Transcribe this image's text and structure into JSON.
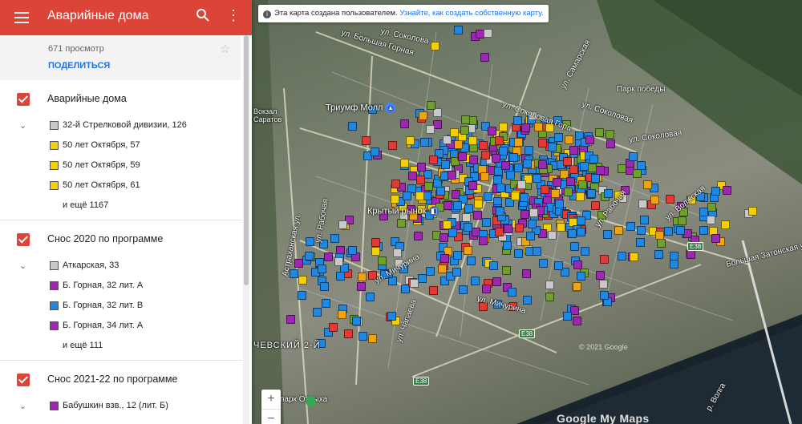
{
  "app": {
    "title": "Аварийные дома",
    "views": "671 просмотр",
    "share_label": "ПОДЕЛИТЬСЯ"
  },
  "colors": {
    "header": "#db4437",
    "gray": "#c9c9c9",
    "yellow": "#f5d000",
    "purple": "#9c27b0",
    "blue": "#1e88e5",
    "green": "#6f9f2c",
    "orange": "#f0a30a",
    "red": "#e53935"
  },
  "layers": [
    {
      "title": "Аварийные дома",
      "items": [
        {
          "label": "32-й Стрелковой дивизии, 126",
          "color": "#c9c9c9"
        },
        {
          "label": "50 лет Октября, 57",
          "color": "#f5d000"
        },
        {
          "label": "50 лет Октября, 59",
          "color": "#f5d000"
        },
        {
          "label": "50 лет Октября, 61",
          "color": "#f5d000"
        }
      ],
      "more": "и ещё 1167"
    },
    {
      "title": "Снос 2020 по программе",
      "items": [
        {
          "label": "Аткарская, 33",
          "color": "#c9c9c9"
        },
        {
          "label": "Б. Горная, 32 лит. А",
          "color": "#9c27b0"
        },
        {
          "label": "Б. Горная, 32 лит. В",
          "color": "#1e88e5"
        },
        {
          "label": "Б. Горная, 34 лит. А",
          "color": "#9c27b0"
        }
      ],
      "more": "и ещё 111"
    },
    {
      "title": "Снос 2021-22 по программе",
      "items": [
        {
          "label": "Бабушкин взв., 12 (лит. Б)",
          "color": "#9c27b0"
        }
      ],
      "more": ""
    }
  ],
  "map": {
    "notice_text": "Эта карта создана пользователем.",
    "notice_link": "Узнайте, как создать собственную карту.",
    "zoom_in": "+",
    "zoom_out": "−",
    "copyright": "© 2021 Google",
    "brand": "Google My Maps",
    "labels": {
      "soc_street": "ул. Соколовая",
      "sokolova": "ул. Соколова",
      "sokolov_gora": "ул. Соколовая Гора",
      "bolsh_gornaya": "ул. Большая Горная",
      "samarskaya": "ул. Самарская",
      "rabochaya": "ул. Рабочая",
      "astrakh": "Астраханская ул.",
      "chapaeva": "ул. Чапаева",
      "michurina": "ул. Мичурина",
      "volzhskaya": "ул. Волжская",
      "zaton": "Большая Затонская ул.",
      "park_pobedy": "Парк победы",
      "volga": "р. Волга",
      "city_park": "парк Отдыха",
      "chevsky": "ЧЕВСКИЙ 2-Й"
    },
    "poi": {
      "mall": "Триумф Молл",
      "market": "Крытый рынок",
      "vokzal": "Вокзал Саратов"
    },
    "roads": {
      "e38a": "E38",
      "e38b": "E38",
      "e38c": "E38"
    }
  }
}
